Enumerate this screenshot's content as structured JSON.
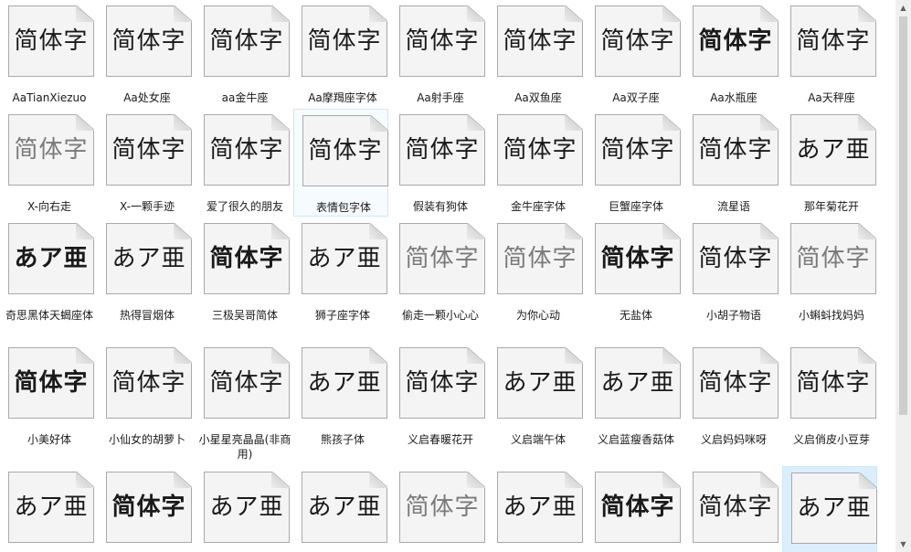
{
  "samples": {
    "hanzi": "简体字",
    "kana": "あア亜"
  },
  "fonts": [
    {
      "label": "AaTianXiezuo",
      "sample": "hanzi",
      "style": ""
    },
    {
      "label": "Aa处女座",
      "sample": "hanzi",
      "style": ""
    },
    {
      "label": "aa金牛座",
      "sample": "hanzi",
      "style": ""
    },
    {
      "label": "Aa摩羯座字体",
      "sample": "hanzi",
      "style": ""
    },
    {
      "label": "Aa射手座",
      "sample": "hanzi",
      "style": ""
    },
    {
      "label": "Aa双鱼座",
      "sample": "hanzi",
      "style": ""
    },
    {
      "label": "Aa双子座",
      "sample": "hanzi",
      "style": ""
    },
    {
      "label": "Aa水瓶座",
      "sample": "hanzi",
      "style": "bold"
    },
    {
      "label": "Aa天秤座",
      "sample": "hanzi",
      "style": ""
    },
    {
      "label": "X-向右走",
      "sample": "hanzi",
      "style": "light"
    },
    {
      "label": "X-一颗手迹",
      "sample": "hanzi",
      "style": ""
    },
    {
      "label": "爱了很久的朋友",
      "sample": "hanzi",
      "style": ""
    },
    {
      "label": "表情包字体",
      "sample": "hanzi",
      "style": ""
    },
    {
      "label": "假装有狗体",
      "sample": "hanzi",
      "style": ""
    },
    {
      "label": "金牛座字体",
      "sample": "hanzi",
      "style": ""
    },
    {
      "label": "巨蟹座字体",
      "sample": "hanzi",
      "style": ""
    },
    {
      "label": "流星语",
      "sample": "hanzi",
      "style": ""
    },
    {
      "label": "那年菊花开",
      "sample": "kana",
      "style": "serif"
    },
    {
      "label": "奇思黑体天蝎座体",
      "sample": "kana",
      "style": "bold"
    },
    {
      "label": "热得冒烟体",
      "sample": "kana",
      "style": "serif"
    },
    {
      "label": "三极吴哥简体",
      "sample": "hanzi",
      "style": "bold"
    },
    {
      "label": "狮子座字体",
      "sample": "kana",
      "style": "serif"
    },
    {
      "label": "偷走一颗小心心",
      "sample": "hanzi",
      "style": "light"
    },
    {
      "label": "为你心动",
      "sample": "hanzi",
      "style": "light"
    },
    {
      "label": "无盐体",
      "sample": "hanzi",
      "style": "bold"
    },
    {
      "label": "小胡子物语",
      "sample": "hanzi",
      "style": ""
    },
    {
      "label": "小蝌蚪找妈妈",
      "sample": "hanzi",
      "style": "light"
    },
    {
      "label": "小美好体",
      "sample": "hanzi",
      "style": "bold"
    },
    {
      "label": "小仙女的胡萝卜",
      "sample": "hanzi",
      "style": ""
    },
    {
      "label": "小星星亮晶晶(非商用)",
      "sample": "hanzi",
      "style": ""
    },
    {
      "label": "熊孩子体",
      "sample": "kana",
      "style": "serif"
    },
    {
      "label": "义启春暖花开",
      "sample": "hanzi",
      "style": ""
    },
    {
      "label": "义启端午体",
      "sample": "kana",
      "style": "serif"
    },
    {
      "label": "义启蓝瘦香菇体",
      "sample": "kana",
      "style": "serif"
    },
    {
      "label": "义启妈妈咪呀",
      "sample": "hanzi",
      "style": ""
    },
    {
      "label": "义启俏皮小豆芽",
      "sample": "hanzi",
      "style": ""
    },
    {
      "label": "",
      "sample": "kana",
      "style": "serif"
    },
    {
      "label": "",
      "sample": "hanzi",
      "style": "bold"
    },
    {
      "label": "",
      "sample": "kana",
      "style": "serif"
    },
    {
      "label": "",
      "sample": "kana",
      "style": "serif"
    },
    {
      "label": "",
      "sample": "hanzi",
      "style": "light"
    },
    {
      "label": "",
      "sample": "kana",
      "style": "serif"
    },
    {
      "label": "",
      "sample": "hanzi",
      "style": "bold"
    },
    {
      "label": "",
      "sample": "hanzi",
      "style": ""
    },
    {
      "label": "",
      "sample": "kana",
      "style": "serif"
    }
  ],
  "hover_index": 12,
  "selected_index": 44,
  "icons": {
    "scroll_up": "scroll-up-arrow-icon",
    "scroll_down": "scroll-down-arrow-icon"
  }
}
